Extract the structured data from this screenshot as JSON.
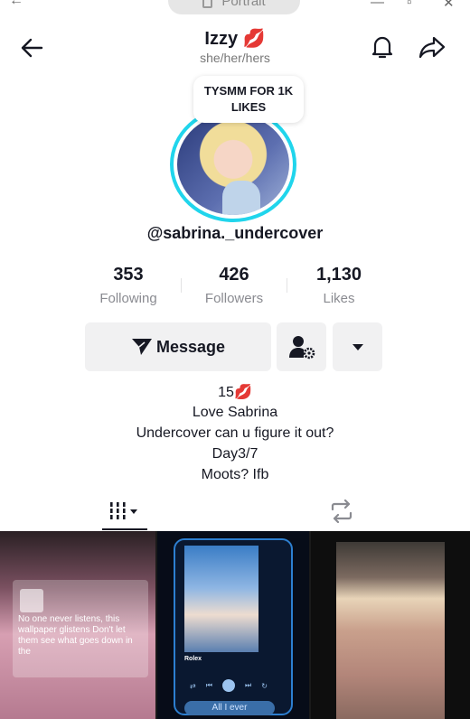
{
  "window": {
    "mode_label": "Portrait"
  },
  "profile": {
    "name": "Izzy 💋",
    "pronouns": "she/her/hers",
    "note": "TYSMM FOR 1K LIKES",
    "handle": "@sabrina._undercover"
  },
  "stats": [
    {
      "value": "353",
      "label": "Following"
    },
    {
      "value": "426",
      "label": "Followers"
    },
    {
      "value": "1,130",
      "label": "Likes"
    }
  ],
  "actions": {
    "message_label": "Message"
  },
  "bio": [
    "15💋",
    "Love Sabrina",
    "Undercover can u figure it out?",
    "Day3/7",
    "Moots? Ifb"
  ],
  "posts": {
    "lyric": "No one never listens, this wallpaper glistens Don't let them see what goes down in the",
    "song_title": "Rolex",
    "player_bar": "All I ever"
  },
  "colors": {
    "ring": "#20d5ec",
    "accent_lips": "#e0334a"
  }
}
